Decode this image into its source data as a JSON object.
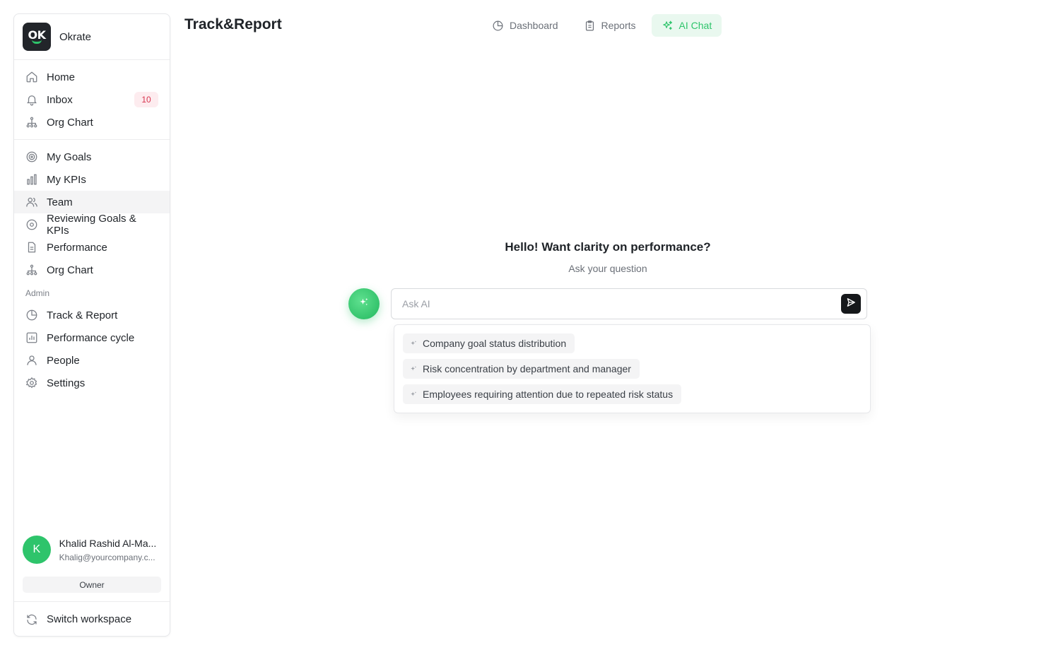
{
  "workspace": {
    "logo_text": "OK",
    "name": "Okrate"
  },
  "nav_main": [
    {
      "label": "Home",
      "icon": "home-icon"
    },
    {
      "label": "Inbox",
      "icon": "bell-icon",
      "badge": "10"
    },
    {
      "label": "Org Chart",
      "icon": "org-chart-icon"
    }
  ],
  "nav_personal": [
    {
      "label": "My Goals",
      "icon": "target-icon"
    },
    {
      "label": "My KPIs",
      "icon": "bar-chart-icon"
    },
    {
      "label": "Team",
      "icon": "users-icon",
      "active": true
    },
    {
      "label": "Reviewing Goals & KPIs",
      "icon": "eye-icon"
    },
    {
      "label": "Performance",
      "icon": "document-icon"
    },
    {
      "label": "Org Chart",
      "icon": "org-chart-icon"
    }
  ],
  "admin": {
    "label": "Admin",
    "items": [
      {
        "label": "Track & Report",
        "icon": "pie-chart-icon"
      },
      {
        "label": "Performance cycle",
        "icon": "chart-square-icon"
      },
      {
        "label": "People",
        "icon": "user-icon"
      },
      {
        "label": "Settings",
        "icon": "gear-icon"
      }
    ]
  },
  "user": {
    "initial": "K",
    "name": "Khalid Rashid Al-Ma...",
    "email": "Khalig@yourcompany.c...",
    "role": "Owner"
  },
  "switch_workspace": "Switch workspace",
  "header": {
    "title": "Track&Report",
    "tabs": [
      {
        "label": "Dashboard",
        "icon": "pie-chart-icon"
      },
      {
        "label": "Reports",
        "icon": "clipboard-icon"
      },
      {
        "label": "AI Chat",
        "icon": "sparkles-icon",
        "active": true
      }
    ]
  },
  "chat": {
    "greeting": "Hello! Want clarity on performance?",
    "subtitle": "Ask your question",
    "input_placeholder": "Ask AI",
    "suggestions": [
      "Company goal status distribution",
      "Risk concentration by department and manager",
      "Employees requiring attention due to repeated risk status"
    ]
  },
  "colors": {
    "accent": "#2ec46b",
    "accent_bg": "#e9f8ef",
    "badge_bg": "#fdecef",
    "badge_text": "#d8344e"
  }
}
